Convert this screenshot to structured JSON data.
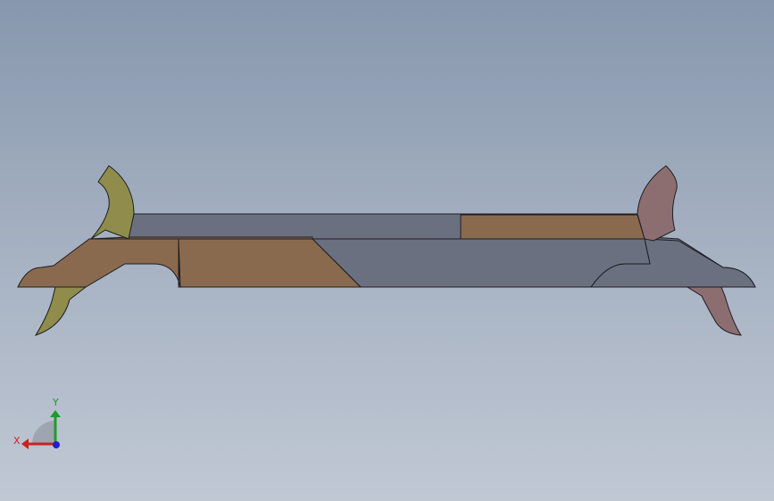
{
  "viewport": {
    "background_top": "#8797ad",
    "background_bottom": "#c0c8d4"
  },
  "model": {
    "colors": {
      "body_gray": "#6b7080",
      "wood_brown": "#8a6a4e",
      "olive_part": "#8f8c4c",
      "mauve_part": "#8d6e70",
      "edge": "#1e1e22"
    }
  },
  "triad": {
    "x_label": "X",
    "y_label": "Y",
    "x_color": "#cc2020",
    "y_color": "#1f9a2a",
    "z_color": "#2020cc"
  }
}
